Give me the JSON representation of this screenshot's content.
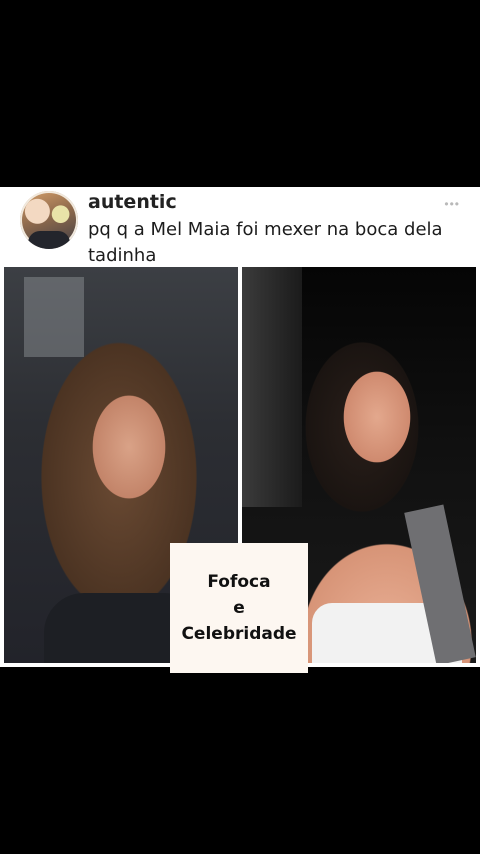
{
  "post": {
    "username": "autentic",
    "more_label": "•••",
    "text": "pq q a Mel Maia foi mexer na boca dela tadinha"
  },
  "watermark": {
    "line1": "Fofoca",
    "line2": "e",
    "line3": "Celebridade"
  }
}
